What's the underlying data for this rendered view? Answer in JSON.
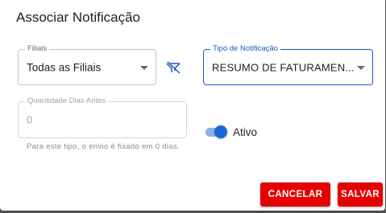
{
  "dialog": {
    "title": "Associar Notificação"
  },
  "fields": {
    "filiais": {
      "label": "Filiais",
      "value": "Todas as Filiais",
      "icon": "chevron-down-icon"
    },
    "tipo_notificacao": {
      "label": "Tipo de Notificação",
      "value": "RESUMO DE FATURAMEN...",
      "icon": "chevron-down-icon"
    },
    "quantidade_dias_antes": {
      "label": "Quantidade Dias Antes",
      "placeholder": "0",
      "helper": "Para este tipo, o envio é fixado em 0 dias."
    }
  },
  "clear_filter_icon": "filter-off-icon",
  "toggle": {
    "label": "Ativo",
    "checked": true
  },
  "buttons": {
    "cancel": "CANCELAR",
    "save": "SALVAR"
  },
  "colors": {
    "primary": "#1a66d2",
    "focus_border": "#1a56c6",
    "button": "#e60000"
  }
}
